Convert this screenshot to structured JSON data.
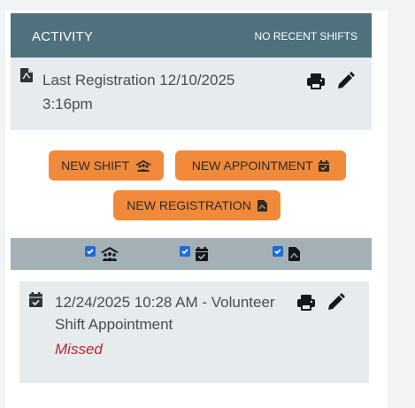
{
  "activity": {
    "title": "ACTIVITY",
    "status": "NO RECENT SHIFTS"
  },
  "registration": {
    "text": "Last Registration 12/10/2025 3:16pm",
    "icon": "file-document-icon"
  },
  "buttons": {
    "new_shift": "NEW SHIFT",
    "new_appointment": "NEW APPOINTMENT",
    "new_registration": "NEW REGISTRATION"
  },
  "filters": [
    {
      "icon": "people-roof-icon",
      "checked": true
    },
    {
      "icon": "calendar-check-icon",
      "checked": true
    },
    {
      "icon": "file-document-icon",
      "checked": true
    }
  ],
  "appointment": {
    "text": "12/24/2025 10:28 AM - Volunteer Shift Appointment",
    "status": "Missed",
    "icon": "calendar-check-icon"
  },
  "colors": {
    "header_bg": "#4e717d",
    "row_bg": "#e6ebee",
    "button_bg": "#f08a3a",
    "filter_bar_bg": "#a3b0b6",
    "checkbox": "#1f6ad6",
    "missed": "#c0272d"
  }
}
